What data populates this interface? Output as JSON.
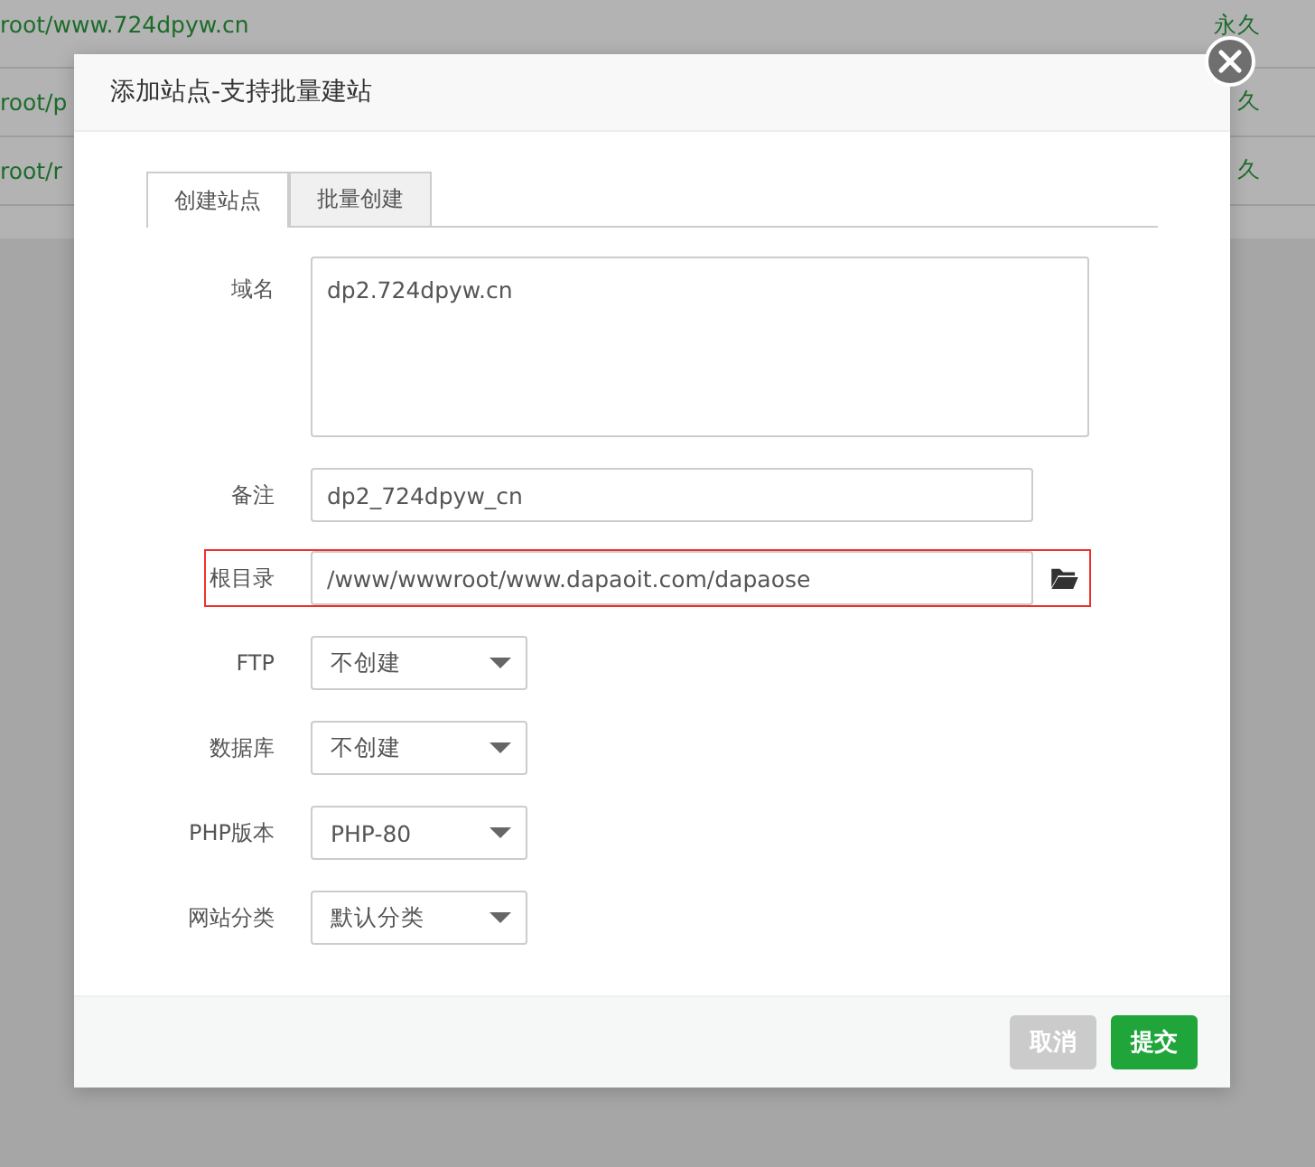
{
  "background_rows": [
    {
      "path": "root/www.724dpyw.cn",
      "expiry": "永久"
    },
    {
      "path": "root/p",
      "expiry": "久"
    },
    {
      "path": "root/r",
      "expiry": "久"
    }
  ],
  "dialog": {
    "title": "添加站点-支持批量建站",
    "tabs": [
      {
        "label": "创建站点",
        "selected": true
      },
      {
        "label": "批量创建",
        "selected": false
      }
    ],
    "fields": [
      {
        "kind": "textarea",
        "label": "域名",
        "value": "dp2.724dpyw.cn",
        "highlighted": false
      },
      {
        "kind": "input",
        "label": "备注",
        "value": "dp2_724dpyw_cn",
        "highlighted": false
      },
      {
        "kind": "path",
        "label": "根目录",
        "value": "/www/wwwroot/www.dapaoit.com/dapaose",
        "highlighted": true
      },
      {
        "kind": "select",
        "label": "FTP",
        "value": "不创建",
        "highlighted": false
      },
      {
        "kind": "select",
        "label": "数据库",
        "value": "不创建",
        "highlighted": false
      },
      {
        "kind": "select",
        "label": "PHP版本",
        "value": "PHP-80",
        "highlighted": false
      },
      {
        "kind": "select",
        "label": "网站分类",
        "value": "默认分类",
        "highlighted": false
      }
    ],
    "buttons": [
      {
        "kind": "cancel",
        "label": "取消"
      },
      {
        "kind": "submit",
        "label": "提交"
      }
    ]
  }
}
